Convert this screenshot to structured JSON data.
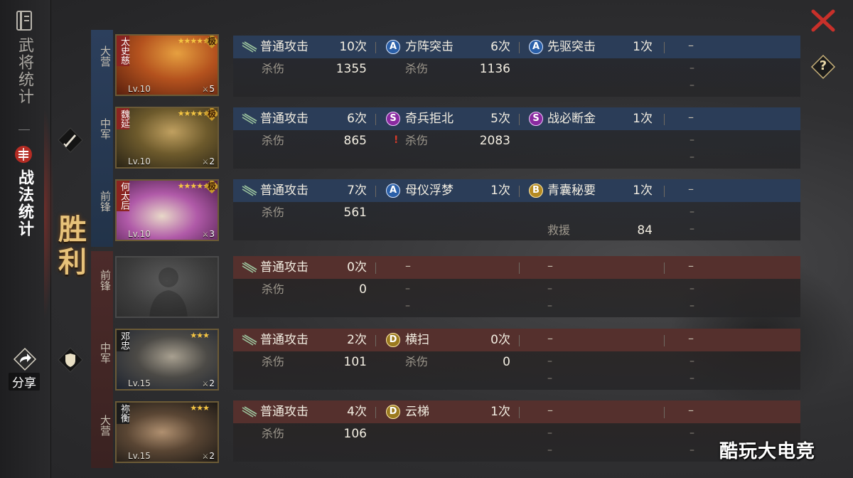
{
  "nav": {
    "general_stats": "武将统计",
    "tactics_stats": "战法统计",
    "share": "分享"
  },
  "result": "胜利",
  "ally_positions": [
    "大营",
    "中军",
    "前锋"
  ],
  "enemy_positions": [
    "前锋",
    "中军",
    "大营"
  ],
  "ally": [
    {
      "name": "太史慈",
      "level": "Lv.10",
      "badge": "5",
      "stars": "★★★★★",
      "rank_mark": "极",
      "attack": {
        "label": "普通攻击",
        "count": "10次",
        "stat_label": "杀伤",
        "stat_value": "1355"
      },
      "skill1": {
        "grade": "A",
        "name": "方阵突击",
        "count": "6次",
        "stat_label": "杀伤",
        "stat_value": "1136"
      },
      "skill2": {
        "grade": "A",
        "name": "先驱突击",
        "count": "1次"
      },
      "skill3": {
        "name": "–"
      }
    },
    {
      "name": "魏延",
      "level": "Lv.10",
      "badge": "2",
      "stars": "★★★★★",
      "rank_mark": "极",
      "attack": {
        "label": "普通攻击",
        "count": "6次",
        "stat_label": "杀伤",
        "stat_value": "865"
      },
      "skill1": {
        "grade": "S",
        "name": "奇兵拒北",
        "count": "5次",
        "stat_label": "杀伤",
        "stat_value": "2083"
      },
      "skill2": {
        "grade": "S",
        "name": "战必断金",
        "count": "1次"
      },
      "skill3": {
        "name": "–"
      }
    },
    {
      "name": "何太后",
      "level": "Lv.10",
      "badge": "3",
      "stars": "★★★★★",
      "rank_mark": "极",
      "attack": {
        "label": "普通攻击",
        "count": "7次",
        "stat_label": "杀伤",
        "stat_value": "561"
      },
      "skill1": {
        "grade": "A",
        "name": "母仪浮梦",
        "count": "1次"
      },
      "skill2": {
        "grade": "B",
        "name": "青囊秘要",
        "count": "1次",
        "stat_label": "救援",
        "stat_value": "84"
      },
      "skill3": {
        "name": "–"
      }
    }
  ],
  "enemy": [
    {
      "name": "",
      "level": "",
      "badge": "",
      "stars": "",
      "attack": {
        "label": "普通攻击",
        "count": "0次",
        "stat_label": "杀伤",
        "stat_value": "0"
      },
      "skill1": {
        "name": "–"
      },
      "skill2": {
        "name": "–"
      },
      "skill3": {
        "name": "–"
      }
    },
    {
      "name": "邓忠",
      "level": "Lv.15",
      "badge": "2",
      "stars": "★★★",
      "attack": {
        "label": "普通攻击",
        "count": "2次",
        "stat_label": "杀伤",
        "stat_value": "101"
      },
      "skill1": {
        "grade": "D",
        "name": "横扫",
        "count": "0次",
        "stat_label": "杀伤",
        "stat_value": "0"
      },
      "skill2": {
        "name": "–"
      },
      "skill3": {
        "name": "–"
      }
    },
    {
      "name": "祢衡",
      "level": "Lv.15",
      "badge": "2",
      "stars": "★★★",
      "attack": {
        "label": "普通攻击",
        "count": "4次",
        "stat_label": "杀伤",
        "stat_value": "106"
      },
      "skill1": {
        "grade": "D",
        "name": "云梯",
        "count": "1次"
      },
      "skill2": {
        "name": "–"
      },
      "skill3": {
        "name": "–"
      }
    }
  ],
  "dash": "–",
  "help": "?",
  "watermark": "酷玩大电竞",
  "colors": {
    "ally_row": "#2b3d58",
    "enemy_row": "#55302d",
    "victory": "#e7c27a",
    "close": "#c8302a"
  }
}
